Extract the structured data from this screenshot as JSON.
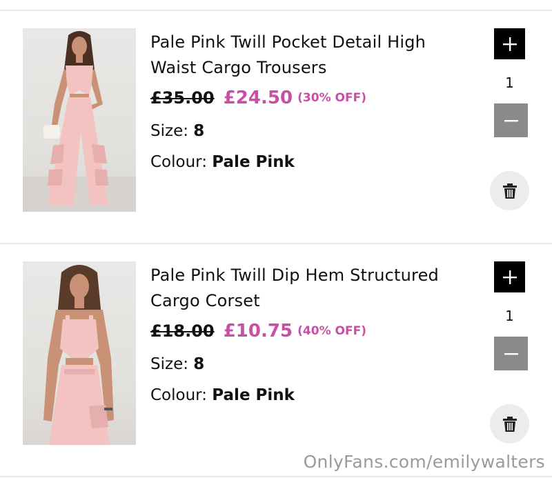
{
  "cart": {
    "items": [
      {
        "title": "Pale Pink Twill Pocket Detail High Waist Cargo Trousers",
        "price_original": "£35.00",
        "price_sale": "£24.50",
        "discount": "(30% OFF)",
        "size_label": "Size:",
        "size_value": "8",
        "colour_label": "Colour:",
        "colour_value": "Pale Pink",
        "quantity": "1",
        "image_alt": "Pale Pink Twill Pocket Detail High Waist Cargo Trousers"
      },
      {
        "title": "Pale Pink Twill Dip Hem Structured Cargo Corset",
        "price_original": "£18.00",
        "price_sale": "£10.75",
        "discount": "(40% OFF)",
        "size_label": "Size:",
        "size_value": "8",
        "colour_label": "Colour:",
        "colour_value": "Pale Pink",
        "quantity": "1",
        "image_alt": "Pale Pink Twill Dip Hem Structured Cargo Corset"
      }
    ]
  },
  "watermark": "OnlyFans.com/emilywalters",
  "colors": {
    "sale_price": "#c94fa5",
    "plus_button": "#000000",
    "minus_button": "#8a8a8a",
    "trash_button": "#ececec",
    "product_pink": "#f2c3c1"
  },
  "icons": {
    "plus": "plus-icon",
    "minus": "minus-icon",
    "delete": "trash-icon"
  }
}
